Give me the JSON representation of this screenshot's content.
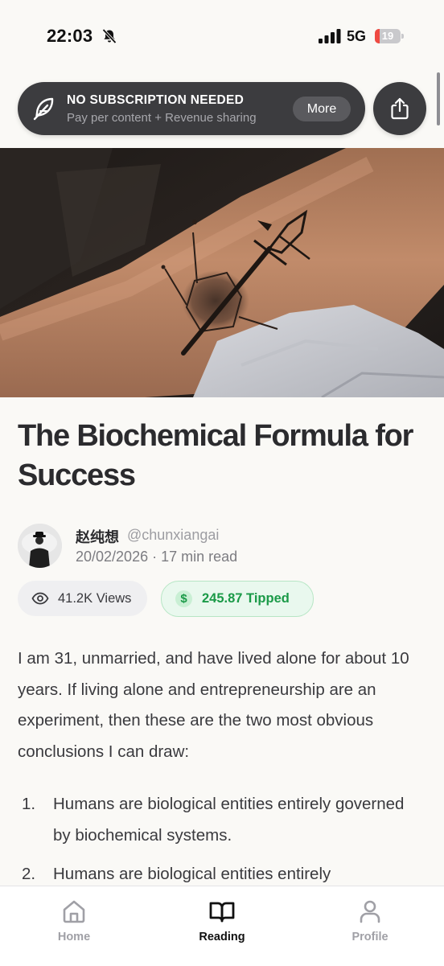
{
  "status_bar": {
    "time": "22:03",
    "network": "5G",
    "battery": 19,
    "battery_label": "19"
  },
  "banner": {
    "title": "NO SUBSCRIPTION NEEDED",
    "subtitle": "Pay per content + Revenue sharing",
    "more_label": "More"
  },
  "article": {
    "title": "The Biochemical Formula for Success",
    "author_name": "赵纯想",
    "author_handle": "@chunxiangai",
    "meta": "20/02/2026 · 17 min read",
    "views": "41.2K Views",
    "tipped": "245.87 Tipped",
    "tip_symbol": "$",
    "paragraph": "I am 31, unmarried, and have lived alone for about 10 years. If living alone and entrepreneurship are an experiment, then these are the two most obvious conclusions I can draw:",
    "list": [
      {
        "num": "1.",
        "text": "Humans are biological entities entirely governed by biochemical systems."
      },
      {
        "num": "2.",
        "text": "Humans are biological entities entirely"
      }
    ]
  },
  "tabbar": {
    "items": [
      {
        "label": "Home",
        "icon": "home-icon"
      },
      {
        "label": "Reading",
        "icon": "book-icon"
      },
      {
        "label": "Profile",
        "icon": "person-icon"
      }
    ],
    "active": "Reading"
  },
  "colors": {
    "accent_green": "#1b9a48",
    "banner_bg": "#3c3c3f",
    "battery_low": "#ef4a42"
  }
}
